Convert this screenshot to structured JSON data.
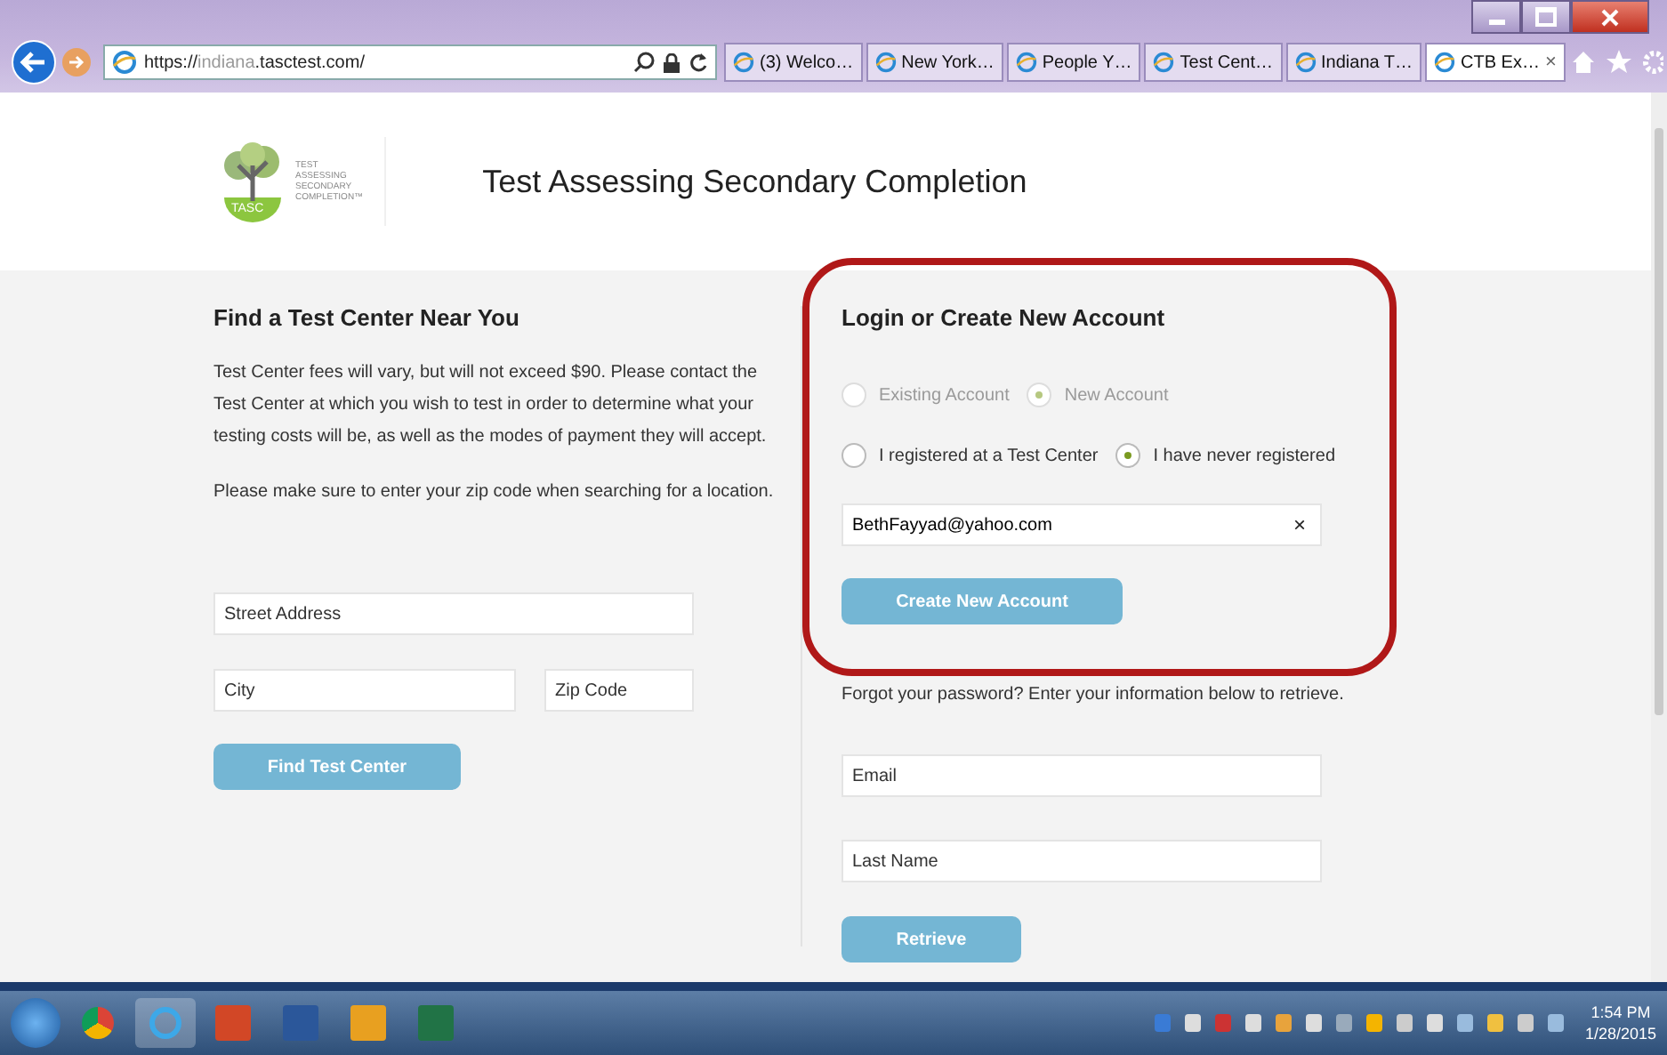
{
  "browser": {
    "url_scheme": "https://",
    "url_host": "indiana",
    "url_rest": ".tasctest.com/",
    "tabs": [
      {
        "label": "(3) Welco…",
        "selected": false
      },
      {
        "label": "New York…",
        "selected": false
      },
      {
        "label": "People Y…",
        "selected": false
      },
      {
        "label": "Test Cent…",
        "selected": false
      },
      {
        "label": "Indiana T…",
        "selected": false
      },
      {
        "label": "CTB Ex…",
        "selected": true,
        "close": "×"
      }
    ]
  },
  "header": {
    "logo_lines": [
      "TEST",
      "ASSESSING",
      "SECONDARY",
      "COMPLETION™"
    ],
    "logo_badge": "TASC",
    "title": "Test Assessing Secondary Completion"
  },
  "find_center": {
    "heading": "Find a Test Center Near You",
    "paragraphs": [
      "Test Center fees will vary, but will not exceed $90.  Please contact the Test Center at which you wish to test in order to determine what your testing costs will be, as well as the modes of payment they will accept.",
      "Please make sure to enter your zip code when searching for a location."
    ],
    "street": {
      "placeholder": "Street Address"
    },
    "city": {
      "placeholder": "City"
    },
    "zip": {
      "placeholder": "Zip Code"
    },
    "button": "Find Test Center"
  },
  "login": {
    "heading": "Login or Create New Account",
    "highlighted": true,
    "radio_groups": [
      [
        {
          "label": "Existing Account",
          "selected": false,
          "disabled": true
        },
        {
          "label": "New Account",
          "selected": true,
          "disabled": true
        }
      ],
      [
        {
          "label": "I registered at a Test Center",
          "selected": false,
          "disabled": false
        },
        {
          "label": "I have never registered",
          "selected": true,
          "disabled": false
        }
      ]
    ],
    "email": {
      "value": "BethFayyad@yahoo.com",
      "clear": "×"
    },
    "button": "Create New Account"
  },
  "retrieve": {
    "prompt": "Forgot your password? Enter your information below to retrieve.",
    "email": {
      "placeholder": "Email"
    },
    "last_name": {
      "placeholder": "Last Name"
    },
    "button": "Retrieve"
  },
  "taskbar": {
    "time": "1:54 PM",
    "date": "1/28/2015"
  }
}
